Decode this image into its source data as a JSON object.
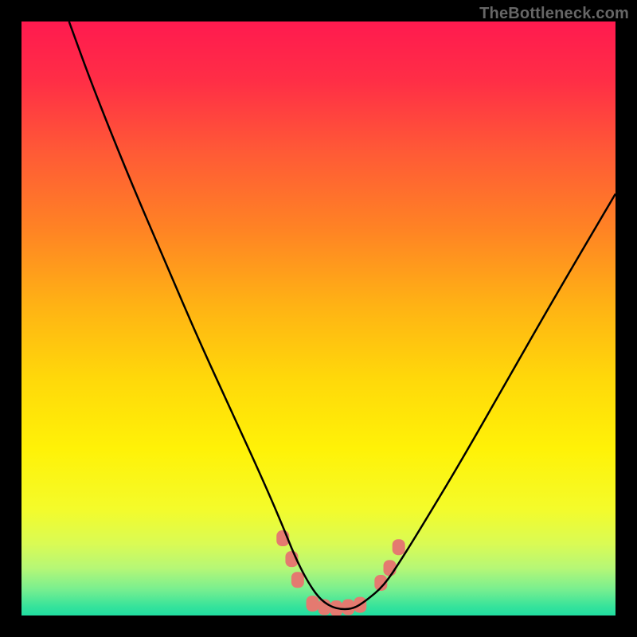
{
  "watermark": "TheBottleneck.com",
  "colors": {
    "bg_black": "#000000",
    "watermark_text": "#666666",
    "curve_stroke": "#000000",
    "marker_fill": "#e47a70",
    "gradient_stops": [
      {
        "offset": 0.0,
        "color": "#ff1a4f"
      },
      {
        "offset": 0.1,
        "color": "#ff2e46"
      },
      {
        "offset": 0.22,
        "color": "#ff5a36"
      },
      {
        "offset": 0.35,
        "color": "#ff8324"
      },
      {
        "offset": 0.48,
        "color": "#ffb314"
      },
      {
        "offset": 0.6,
        "color": "#ffd80a"
      },
      {
        "offset": 0.72,
        "color": "#fff207"
      },
      {
        "offset": 0.82,
        "color": "#f4fb2a"
      },
      {
        "offset": 0.88,
        "color": "#d9fb55"
      },
      {
        "offset": 0.92,
        "color": "#b6f776"
      },
      {
        "offset": 0.955,
        "color": "#7aef8f"
      },
      {
        "offset": 0.985,
        "color": "#36e39b"
      },
      {
        "offset": 1.0,
        "color": "#20dda0"
      }
    ]
  },
  "chart_data": {
    "type": "line",
    "title": "",
    "xlabel": "",
    "ylabel": "",
    "xlim": [
      0,
      100
    ],
    "ylim": [
      0,
      100
    ],
    "note": "Bottleneck-style V-curve. Axes unlabeled; x/y in percentage of plot area (0 = left/bottom, 100 = right/top).",
    "series": [
      {
        "name": "bottleneck-curve",
        "x": [
          8,
          12,
          18,
          24,
          30,
          36,
          41,
          44,
          46,
          48,
          50,
          52,
          54,
          56,
          58,
          61,
          64,
          68,
          74,
          82,
          90,
          100
        ],
        "y": [
          100,
          89,
          74,
          60,
          46,
          33,
          22,
          15,
          10,
          6,
          3,
          1.5,
          1,
          1.2,
          2.5,
          5,
          9.5,
          16,
          26,
          40,
          54,
          71
        ]
      }
    ],
    "markers": {
      "name": "highlight-points",
      "note": "Salmon rounded markers near the curve minimum",
      "points": [
        {
          "x": 44.0,
          "y": 13.0
        },
        {
          "x": 45.5,
          "y": 9.5
        },
        {
          "x": 46.5,
          "y": 6.0
        },
        {
          "x": 49.0,
          "y": 2.0
        },
        {
          "x": 51.0,
          "y": 1.4
        },
        {
          "x": 53.0,
          "y": 1.2
        },
        {
          "x": 55.0,
          "y": 1.4
        },
        {
          "x": 57.0,
          "y": 1.8
        },
        {
          "x": 60.5,
          "y": 5.5
        },
        {
          "x": 62.0,
          "y": 8.0
        },
        {
          "x": 63.5,
          "y": 11.5
        }
      ]
    }
  }
}
